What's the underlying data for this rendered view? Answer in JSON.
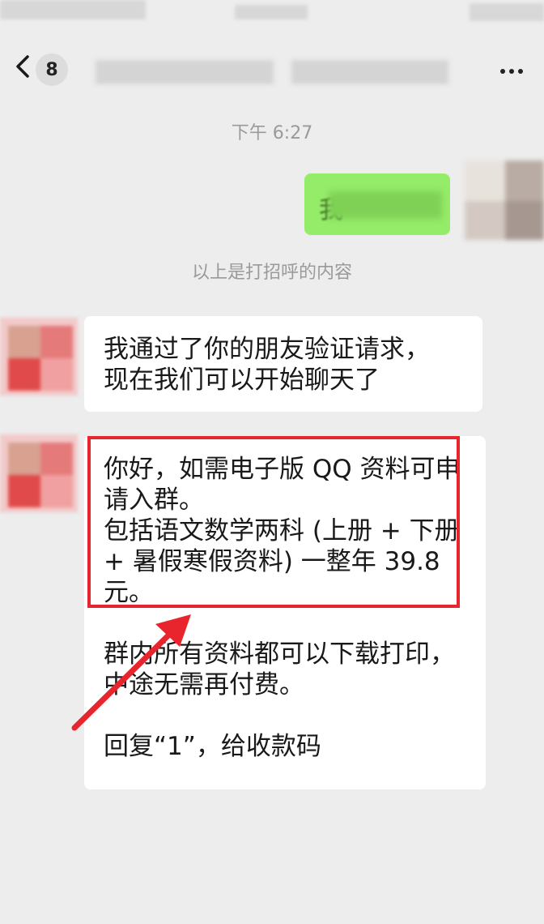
{
  "header": {
    "unread_count": "8",
    "back_icon": "chevron-left-icon",
    "more_icon": "more-dots-icon"
  },
  "chat": {
    "timestamp": "下午 6:27",
    "outgoing_first_char": "我",
    "system_note": "以上是打招呼的内容",
    "message1": "我通过了你的朋友验证请求，\n现在我们可以开始聊天了",
    "message2_part1": "你好，如需电子版 QQ 资料可申\n请入群。\n包括语文数学两科 (上册 + 下册\n+ 暑假寒假资料) 一整年 39.8\n元。",
    "message2_part2": "群内所有资料都可以下载打印，\n中途无需再付费。",
    "message2_part3": "回复“1”，给收款码"
  },
  "colors": {
    "background": "#ededed",
    "outgoing_bubble": "#95ec69",
    "incoming_bubble": "#ffffff",
    "annotation_red": "#e8242c"
  }
}
